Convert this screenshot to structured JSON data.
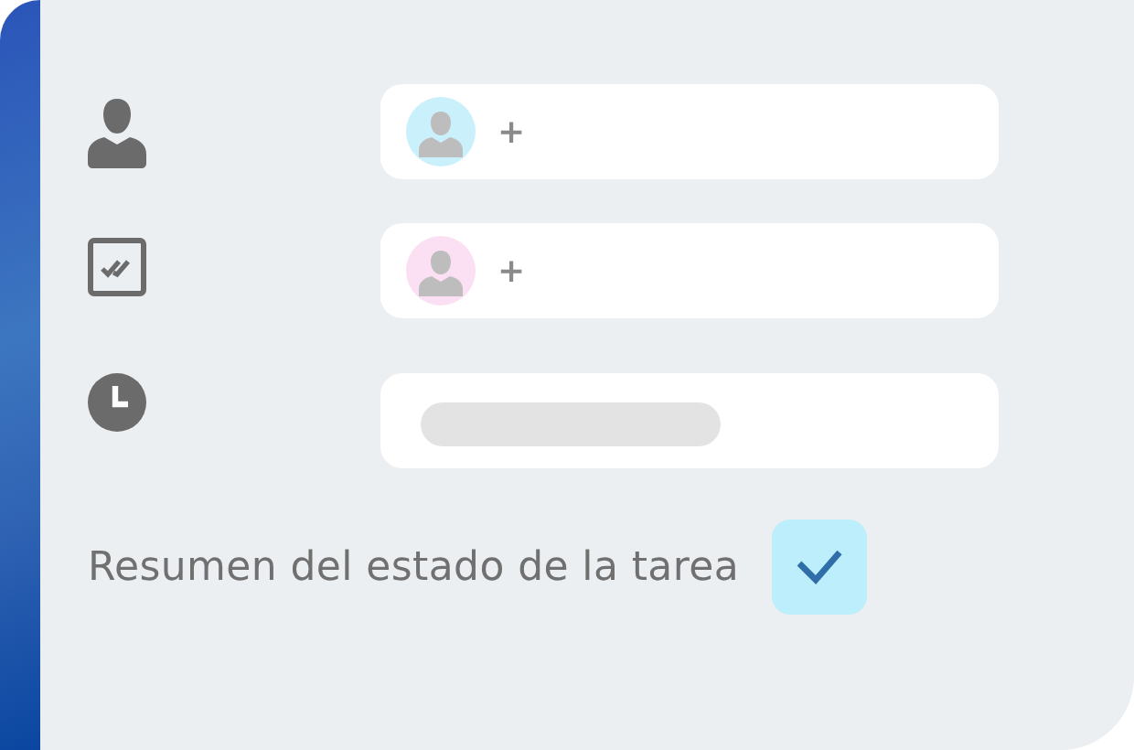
{
  "rows": [
    {
      "kind": "person",
      "field": {
        "kind": "assignee",
        "color": "#c9f0fb",
        "add": "+"
      }
    },
    {
      "kind": "checklist",
      "field": {
        "kind": "assignee",
        "color": "#fbdff2",
        "add": "+"
      }
    },
    {
      "kind": "clock",
      "field": {
        "kind": "skeleton"
      }
    }
  ],
  "summary": {
    "label": "Resumen del estado de la tarea",
    "checked": true
  }
}
